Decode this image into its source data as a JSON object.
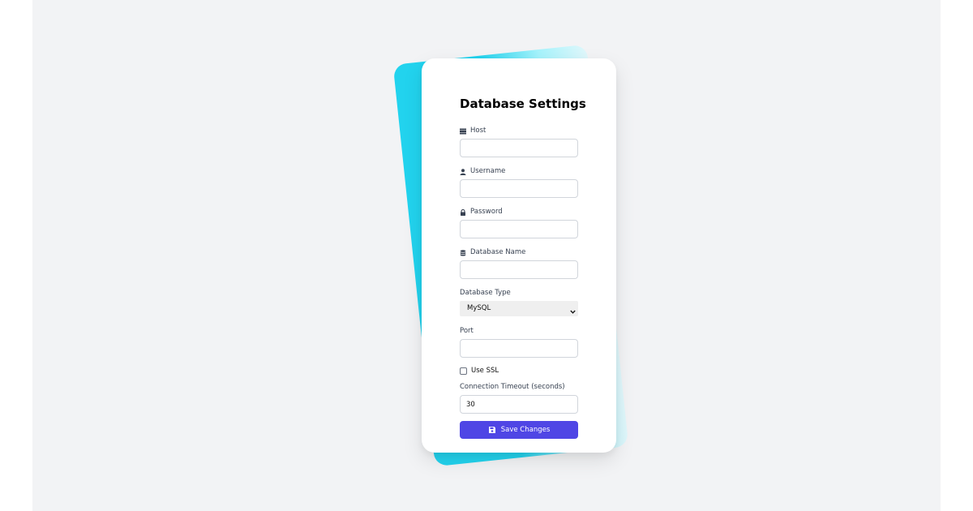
{
  "form": {
    "title": "Database Settings",
    "fields": {
      "host": {
        "label": "Host",
        "icon": "server-icon",
        "value": ""
      },
      "username": {
        "label": "Username",
        "icon": "user-icon",
        "value": ""
      },
      "password": {
        "label": "Password",
        "icon": "lock-icon",
        "value": ""
      },
      "database_name": {
        "label": "Database Name",
        "icon": "database-icon",
        "value": ""
      },
      "database_type": {
        "label": "Database Type",
        "selected": "MySQL"
      },
      "port": {
        "label": "Port",
        "value": ""
      },
      "use_ssl": {
        "label": "Use SSL",
        "checked": false
      },
      "timeout": {
        "label": "Connection Timeout (seconds)",
        "value": "30"
      }
    },
    "save_button": {
      "label": "Save Changes",
      "icon": "save-icon"
    }
  },
  "colors": {
    "accent": "#4f46e5",
    "decor_card": "#22d3ee",
    "background": "#f2f3f5"
  }
}
